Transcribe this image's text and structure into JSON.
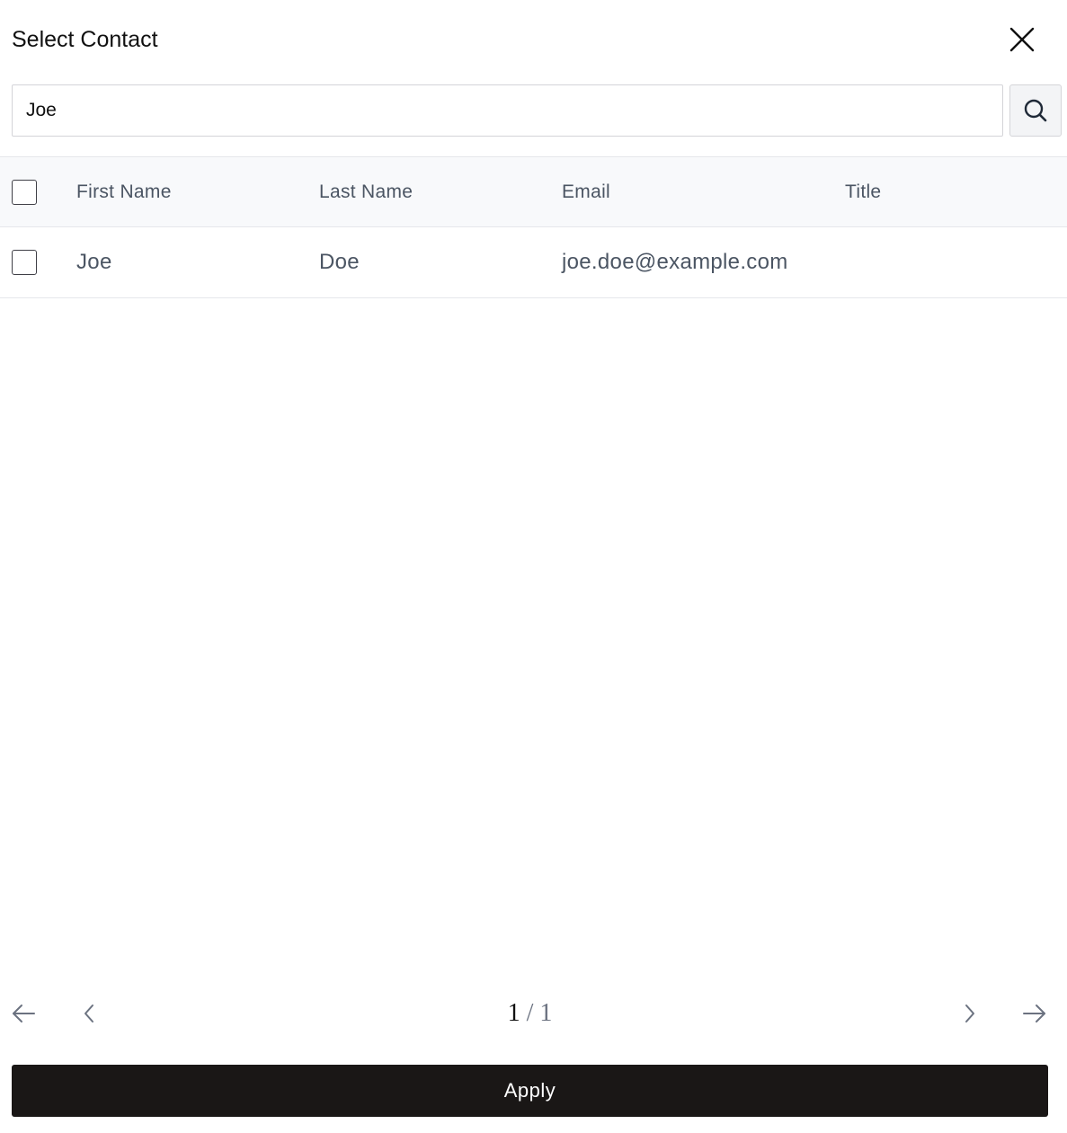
{
  "dialog": {
    "title": "Select Contact"
  },
  "search": {
    "value": "Joe",
    "placeholder": ""
  },
  "table": {
    "columns": [
      "First Name",
      "Last Name",
      "Email",
      "Title"
    ],
    "rows": [
      {
        "first_name": "Joe",
        "last_name": "Doe",
        "email": "joe.doe@example.com",
        "title": ""
      }
    ]
  },
  "pagination": {
    "current": "1",
    "separator": "/",
    "total": "1"
  },
  "footer": {
    "apply_label": "Apply"
  },
  "icons": {
    "close": "close-icon",
    "search": "search-icon",
    "first": "arrow-left-icon",
    "prev": "chevron-left-icon",
    "next": "chevron-right-icon",
    "last": "arrow-right-icon"
  }
}
